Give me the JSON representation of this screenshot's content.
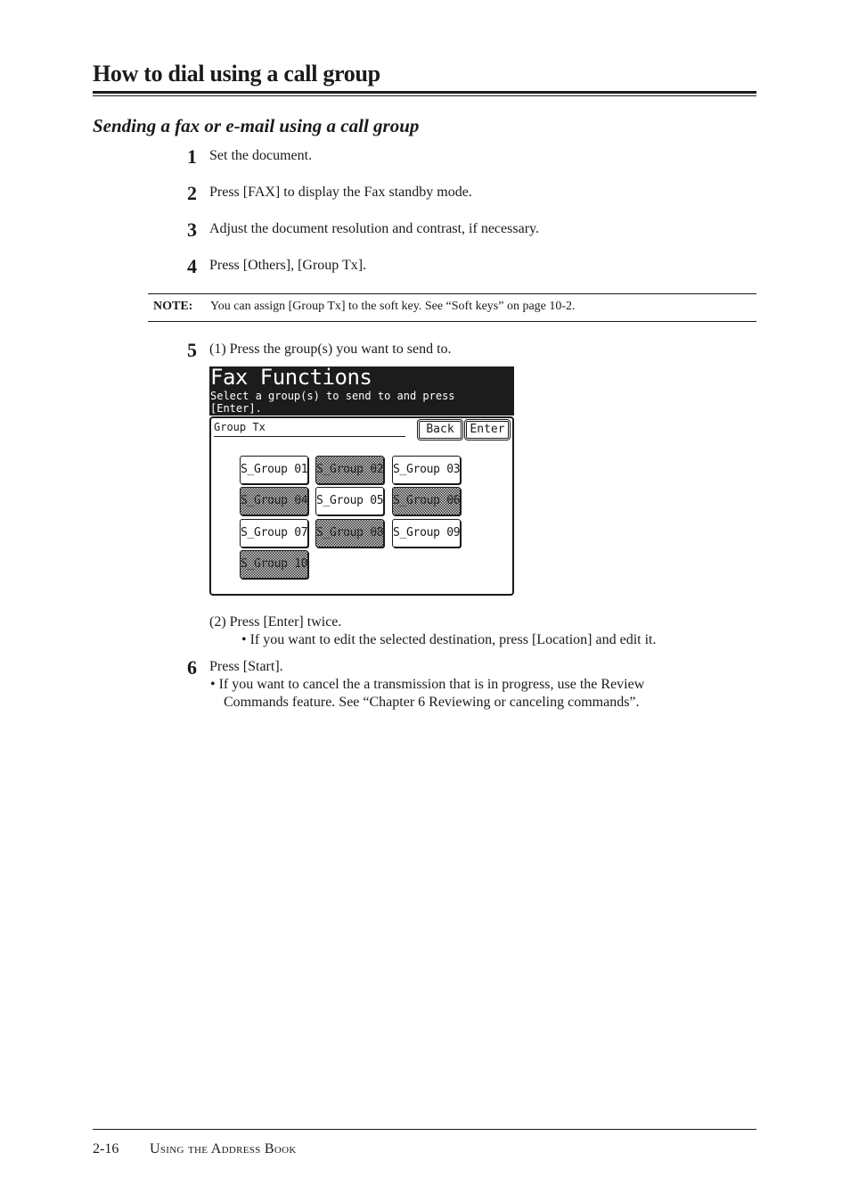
{
  "page": {
    "title": "How to dial using a call group",
    "subtitle": "Sending a fax or e-mail using a call group"
  },
  "steps": [
    {
      "num": "1",
      "text": "Set the document."
    },
    {
      "num": "2",
      "text": "Press [FAX] to display the Fax standby mode."
    },
    {
      "num": "3",
      "text": "Adjust the document resolution and contrast, if necessary."
    },
    {
      "num": "4",
      "text": "Press [Others], [Group Tx]."
    },
    {
      "num": "5",
      "text": "(1) Press the group(s) you want to send to."
    },
    {
      "num": "6",
      "text": "Press [Start]."
    }
  ],
  "note": {
    "label": "NOTE:",
    "text": "You can assign [Group Tx] to the soft key. See “Soft keys” on page 10-2."
  },
  "step5_sub": {
    "text": "(2) Press [Enter] twice.",
    "bullet": "• If you want to edit the selected destination, press [Location] and edit it."
  },
  "step6_bullet": {
    "line1": "• If you want to cancel the a transmission that is in progress, use the Review",
    "line2": "Commands feature. See “Chapter 6 Reviewing or canceling commands”."
  },
  "screen": {
    "title": "Fax Functions",
    "message": "Select a group(s) to send to and press\n[Enter].",
    "field_label": "Group Tx",
    "back_label": "Back",
    "enter_label": "Enter",
    "groups": [
      {
        "label": "S_Group 01",
        "selected": false
      },
      {
        "label": "S_Group 02",
        "selected": true
      },
      {
        "label": "S_Group 03",
        "selected": false
      },
      {
        "label": "S_Group 04",
        "selected": true
      },
      {
        "label": "S_Group 05",
        "selected": false
      },
      {
        "label": "S_Group 06",
        "selected": true
      },
      {
        "label": "S_Group 07",
        "selected": false
      },
      {
        "label": "S_Group 08",
        "selected": true
      },
      {
        "label": "S_Group 09",
        "selected": false
      },
      {
        "label": "S_Group 10",
        "selected": true
      }
    ]
  },
  "footer": {
    "page_number": "2-16",
    "section": "Using the Address Book"
  }
}
